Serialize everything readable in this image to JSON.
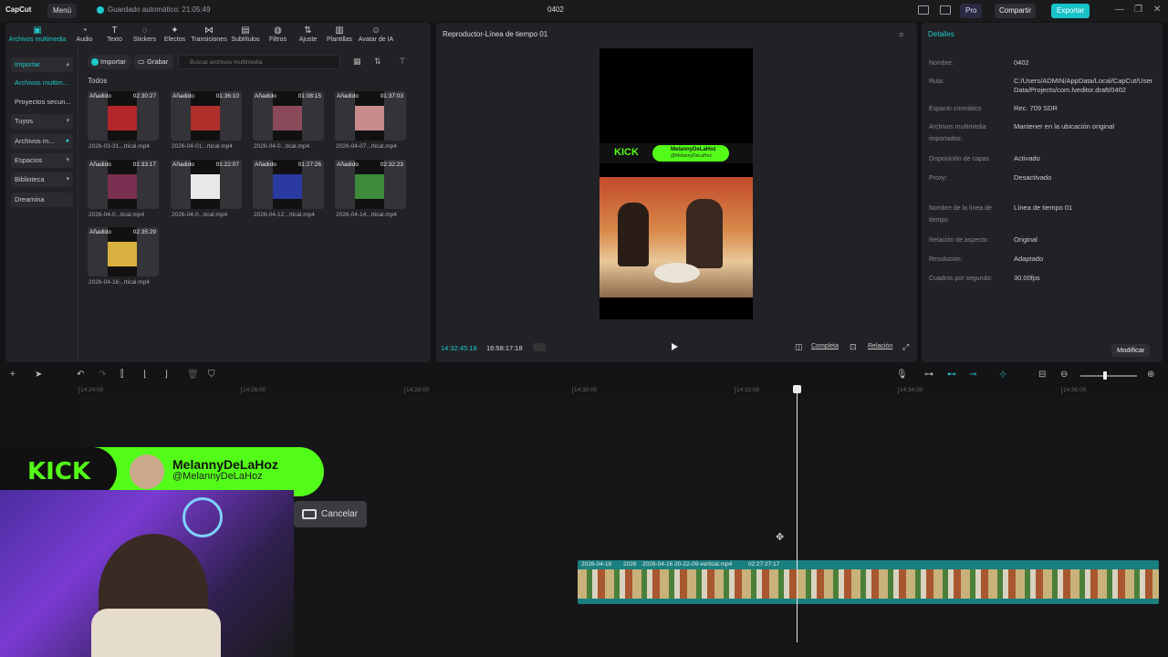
{
  "titlebar": {
    "app": "CapCut",
    "menu": "Menú",
    "autosave": "Guardado automático: 21:05:49",
    "project": "0402",
    "pro": "Pro",
    "share": "Compartir",
    "export": "Exportar"
  },
  "tabs": [
    {
      "label": "Archivos multimedia",
      "icon": "media-icon",
      "active": true
    },
    {
      "label": "Audio",
      "icon": "audio-icon"
    },
    {
      "label": "Texto",
      "icon": "text-icon"
    },
    {
      "label": "Stickers",
      "icon": "sticker-icon"
    },
    {
      "label": "Efectos",
      "icon": "effects-icon"
    },
    {
      "label": "Transiciones",
      "icon": "transition-icon"
    },
    {
      "label": "Subtítulos",
      "icon": "subtitle-icon"
    },
    {
      "label": "Filtros",
      "icon": "filter-icon"
    },
    {
      "label": "Ajuste",
      "icon": "adjust-icon"
    },
    {
      "label": "Plantillas",
      "icon": "template-icon"
    },
    {
      "label": "Avatar de IA",
      "icon": "avatar-icon"
    }
  ],
  "sidebar": {
    "items": [
      "Importar",
      "Archivos multim...",
      "Proyectos secun...",
      "Tuyos",
      "Archivos m...",
      "Espacios",
      "Biblioteca",
      "Dreamina"
    ]
  },
  "media": {
    "import": "Importar",
    "record": "Grabar",
    "search_placeholder": "Buscar archivos multimedia",
    "section": "Todos",
    "items": [
      {
        "badge": "Añadido",
        "duration": "02:30:27",
        "name": "2026-03-31...rtical.mp4"
      },
      {
        "badge": "Añadido",
        "duration": "01:36:10",
        "name": "2026-04-01...rtical.mp4"
      },
      {
        "badge": "Añadido",
        "duration": "01:08:15",
        "name": "2026-04-0...tical.mp4"
      },
      {
        "badge": "Añadido",
        "duration": "01:37:03",
        "name": "2026-04-07...rtical.mp4"
      },
      {
        "badge": "Añadido",
        "duration": "01:33:17",
        "name": "2026-04-0...tical.mp4"
      },
      {
        "badge": "Añadido",
        "duration": "01:22:07",
        "name": "2026-04-0...tical.mp4"
      },
      {
        "badge": "Añadido",
        "duration": "01:27:26",
        "name": "2026-04-12...rtical.mp4"
      },
      {
        "badge": "Añadido",
        "duration": "02:32:23",
        "name": "2026-04-14...rtical.mp4"
      },
      {
        "badge": "Añadido",
        "duration": "02:35:29",
        "name": "2026-04-16...rtical.mp4"
      }
    ]
  },
  "player": {
    "title": "Reproductor-Línea de tiempo 01",
    "current": "14:32:45:18",
    "total": "16:58:17:18",
    "full": "Completa",
    "ratio": "Relación",
    "kick_name": "MelannyDeLaHoz",
    "kick_handle": "@MelannyDeLaHoz"
  },
  "details": {
    "title": "Detalles",
    "rows": [
      {
        "label": "Nombre:",
        "value": "0402"
      },
      {
        "label": "Ruta:",
        "value": "C:/Users/ADMIN/AppData/Local/CapCut/User Data/Projects/com.lveditor.draft/0402"
      },
      {
        "label": "Espacio cromático",
        "value": "Rec. 709 SDR"
      },
      {
        "label": "Archivos multimedia importados:",
        "value": "Mantener en la ubicación original"
      },
      {
        "label": "Disposición de capas",
        "value": "Activado"
      },
      {
        "label": "Proxy:",
        "value": "Desactivado"
      },
      {
        "label": "Nombre de la línea de tiempo",
        "value": "Línea de tiempo 01"
      },
      {
        "label": "Relación de aspecto:",
        "value": "Original"
      },
      {
        "label": "Resolución:",
        "value": "Adaptado"
      },
      {
        "label": "Cuadros por segundo:",
        "value": "30.00fps"
      }
    ],
    "modify": "Modificar"
  },
  "timeline": {
    "ticks": [
      "14:24:00",
      "14:26:00",
      "14:28:00",
      "14:30:00",
      "14:32:00",
      "14:34:00",
      "14:36:00"
    ],
    "clip_labels": [
      "2026-04-16",
      "2026",
      "2026-04-16 20-22-09-vertical.mp4",
      "02:27:27:17"
    ]
  },
  "overlay": {
    "kick": "KICK",
    "name": "MelannyDeLaHoz",
    "handle": "@MelannyDeLaHoz",
    "cancel": "Cancelar"
  }
}
